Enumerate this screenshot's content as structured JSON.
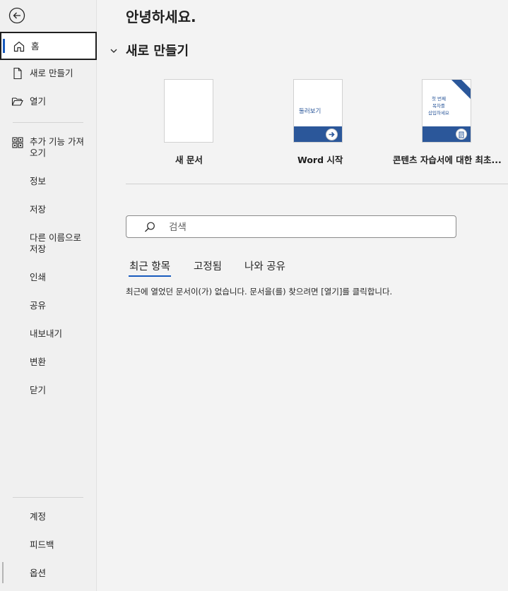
{
  "sidebar": {
    "items": [
      {
        "label": "홈",
        "icon": "home-icon"
      },
      {
        "label": "새로 만들기",
        "icon": "new-document-icon"
      },
      {
        "label": "열기",
        "icon": "open-folder-icon"
      },
      {
        "label": "추가 기능 가져오기",
        "icon": "addins-grid-icon"
      },
      {
        "label": "정보"
      },
      {
        "label": "저장"
      },
      {
        "label": "다른 이름으로 저장"
      },
      {
        "label": "인쇄"
      },
      {
        "label": "공유"
      },
      {
        "label": "내보내기"
      },
      {
        "label": "변환"
      },
      {
        "label": "닫기"
      }
    ],
    "bottom": [
      {
        "label": "계정"
      },
      {
        "label": "피드백"
      },
      {
        "label": "옵션"
      }
    ]
  },
  "main": {
    "greeting": "안녕하세요.",
    "new_section": {
      "title": "새로 만들기",
      "templates": [
        {
          "caption": "새 문서"
        },
        {
          "caption": "Word 시작",
          "thumb_text": "둘러보기"
        },
        {
          "caption": "콘텐츠 자습서에 대한 최초...",
          "thumb_lines": [
            "첫 번째",
            "목차를",
            "삽입하세요"
          ]
        }
      ]
    },
    "search": {
      "placeholder": "검색"
    },
    "tabs": [
      "최근 항목",
      "고정됨",
      "나와 공유"
    ],
    "empty_message": "최근에 열었던 문서이(가) 없습니다. 문서을(를) 찾으려면 [열기]를 클릭합니다."
  },
  "colors": {
    "accent": "#185abd",
    "brand": "#2b579a",
    "sidebar_bg": "#f0f0f0",
    "main_bg": "#f3f3f3"
  }
}
